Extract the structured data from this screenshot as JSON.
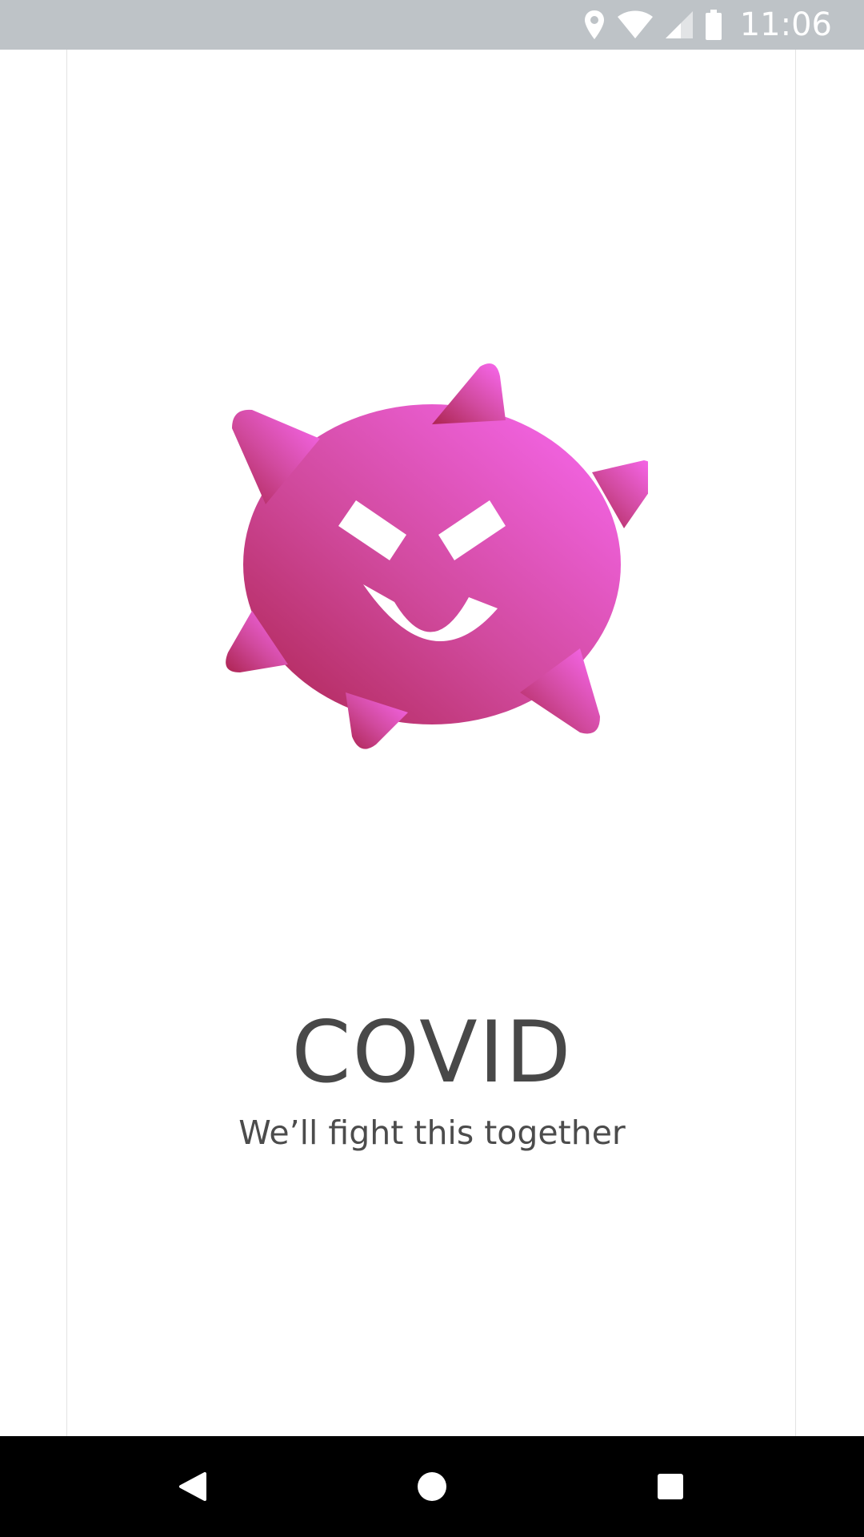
{
  "status_bar": {
    "time": "11:06",
    "icons": [
      "location-icon",
      "wifi-icon",
      "signal-icon",
      "battery-icon"
    ]
  },
  "splash": {
    "title": "COVID",
    "tagline": "We’ll fight this together",
    "mascot_icon": "virus-mascot-icon",
    "colors": {
      "gradient_start": "#ad2451",
      "gradient_end": "#fa69f2",
      "title": "#484848"
    }
  },
  "nav_bar": {
    "buttons": [
      "back-icon",
      "home-icon",
      "recents-icon"
    ]
  }
}
